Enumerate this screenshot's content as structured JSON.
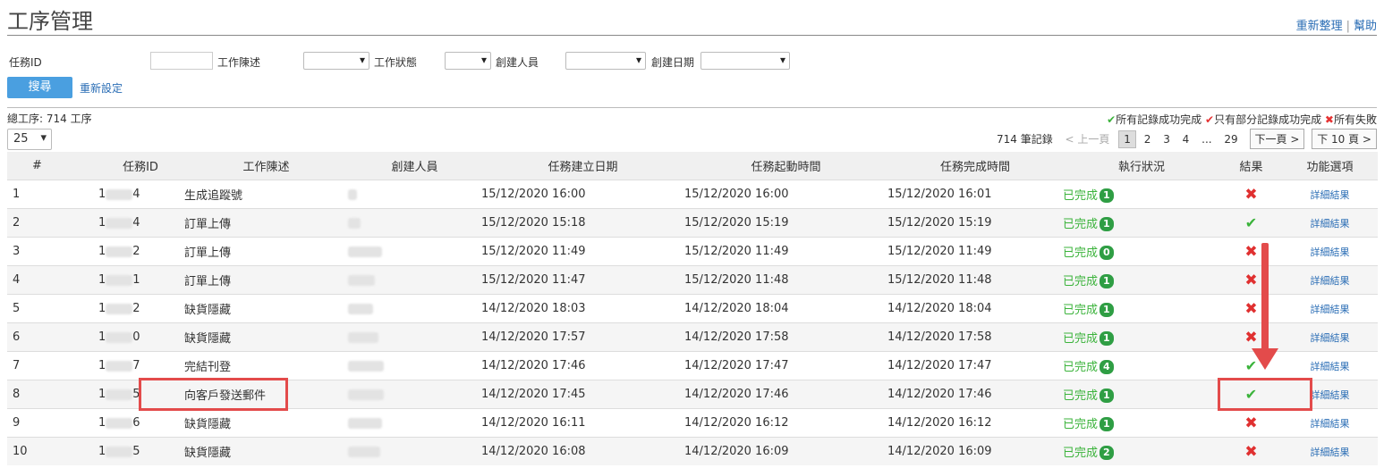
{
  "page": {
    "title": "工序管理",
    "links": [
      "重新整理",
      "幫助"
    ]
  },
  "filters": {
    "task_id_label": "任務ID",
    "desc_label": "工作陳述",
    "status_label": "工作狀態",
    "creator_label": "創建人員",
    "date_label": "創建日期",
    "search_button": "搜尋",
    "reset_link": "重新設定"
  },
  "summary": {
    "total": "總工序: 714 工序",
    "page_size": "25"
  },
  "legend": {
    "all_success": "所有記錄成功完成",
    "partial_success": "只有部分記錄成功完成",
    "all_failed": "所有失敗"
  },
  "pager": {
    "records": "714 筆記錄",
    "prev": "< 上一頁",
    "pages": [
      "1",
      "2",
      "3",
      "4",
      "...",
      "29"
    ],
    "current": "1",
    "next": "下一頁 >",
    "next10": "下 10 頁 >"
  },
  "table": {
    "headers": [
      "#",
      "任務ID",
      "工作陳述",
      "創建人員",
      "任務建立日期",
      "任務起動時間",
      "任務完成時間",
      "執行狀況",
      "結果",
      "功能選項"
    ],
    "rows": [
      {
        "num": "1",
        "id_start": "1",
        "id_end": "4",
        "desc": "生成追蹤號",
        "created": "15/12/2020 16:00",
        "start": "15/12/2020 16:00",
        "end": "15/12/2020 16:01",
        "status": "已完成",
        "count": "1",
        "result": "fail",
        "action": "詳細結果"
      },
      {
        "num": "2",
        "id_start": "1",
        "id_end": "4",
        "desc": "訂單上傳",
        "created": "15/12/2020 15:18",
        "start": "15/12/2020 15:19",
        "end": "15/12/2020 15:19",
        "status": "已完成",
        "count": "1",
        "result": "success",
        "action": "詳細結果"
      },
      {
        "num": "3",
        "id_start": "1",
        "id_end": "2",
        "desc": "訂單上傳",
        "created": "15/12/2020 11:49",
        "start": "15/12/2020 11:49",
        "end": "15/12/2020 11:49",
        "status": "已完成",
        "count": "0",
        "result": "fail",
        "action": "詳細結果"
      },
      {
        "num": "4",
        "id_start": "1",
        "id_end": "1",
        "desc": "訂單上傳",
        "created": "15/12/2020 11:47",
        "start": "15/12/2020 11:48",
        "end": "15/12/2020 11:48",
        "status": "已完成",
        "count": "1",
        "result": "fail",
        "action": "詳細結果"
      },
      {
        "num": "5",
        "id_start": "1",
        "id_end": "2",
        "desc": "缺貨隱藏",
        "created": "14/12/2020 18:03",
        "start": "14/12/2020 18:04",
        "end": "14/12/2020 18:04",
        "status": "已完成",
        "count": "1",
        "result": "fail",
        "action": "詳細結果"
      },
      {
        "num": "6",
        "id_start": "1",
        "id_end": "0",
        "desc": "缺貨隱藏",
        "created": "14/12/2020 17:57",
        "start": "14/12/2020 17:58",
        "end": "14/12/2020 17:58",
        "status": "已完成",
        "count": "1",
        "result": "fail",
        "action": "詳細結果"
      },
      {
        "num": "7",
        "id_start": "1",
        "id_end": "7",
        "desc": "完結刊登",
        "created": "14/12/2020 17:46",
        "start": "14/12/2020 17:47",
        "end": "14/12/2020 17:47",
        "status": "已完成",
        "count": "4",
        "result": "success",
        "action": "詳細結果"
      },
      {
        "num": "8",
        "id_start": "1",
        "id_end": "5",
        "desc": "向客戶發送郵件",
        "created": "14/12/2020 17:45",
        "start": "14/12/2020 17:46",
        "end": "14/12/2020 17:46",
        "status": "已完成",
        "count": "1",
        "result": "success",
        "action": "詳細結果"
      },
      {
        "num": "9",
        "id_start": "1",
        "id_end": "6",
        "desc": "缺貨隱藏",
        "created": "14/12/2020 16:11",
        "start": "14/12/2020 16:12",
        "end": "14/12/2020 16:12",
        "status": "已完成",
        "count": "1",
        "result": "fail",
        "action": "詳細結果"
      },
      {
        "num": "10",
        "id_start": "1",
        "id_end": "5",
        "desc": "缺貨隱藏",
        "created": "14/12/2020 16:08",
        "start": "14/12/2020 16:09",
        "end": "14/12/2020 16:09",
        "status": "已完成",
        "count": "2",
        "result": "fail",
        "action": "詳細結果"
      }
    ]
  },
  "colors": {
    "accent_blue": "#4a9fe0",
    "link_blue": "#2a6db5",
    "success_green": "#3bb33b",
    "fail_red": "#e03030",
    "annotation_red": "#e34b4b"
  }
}
